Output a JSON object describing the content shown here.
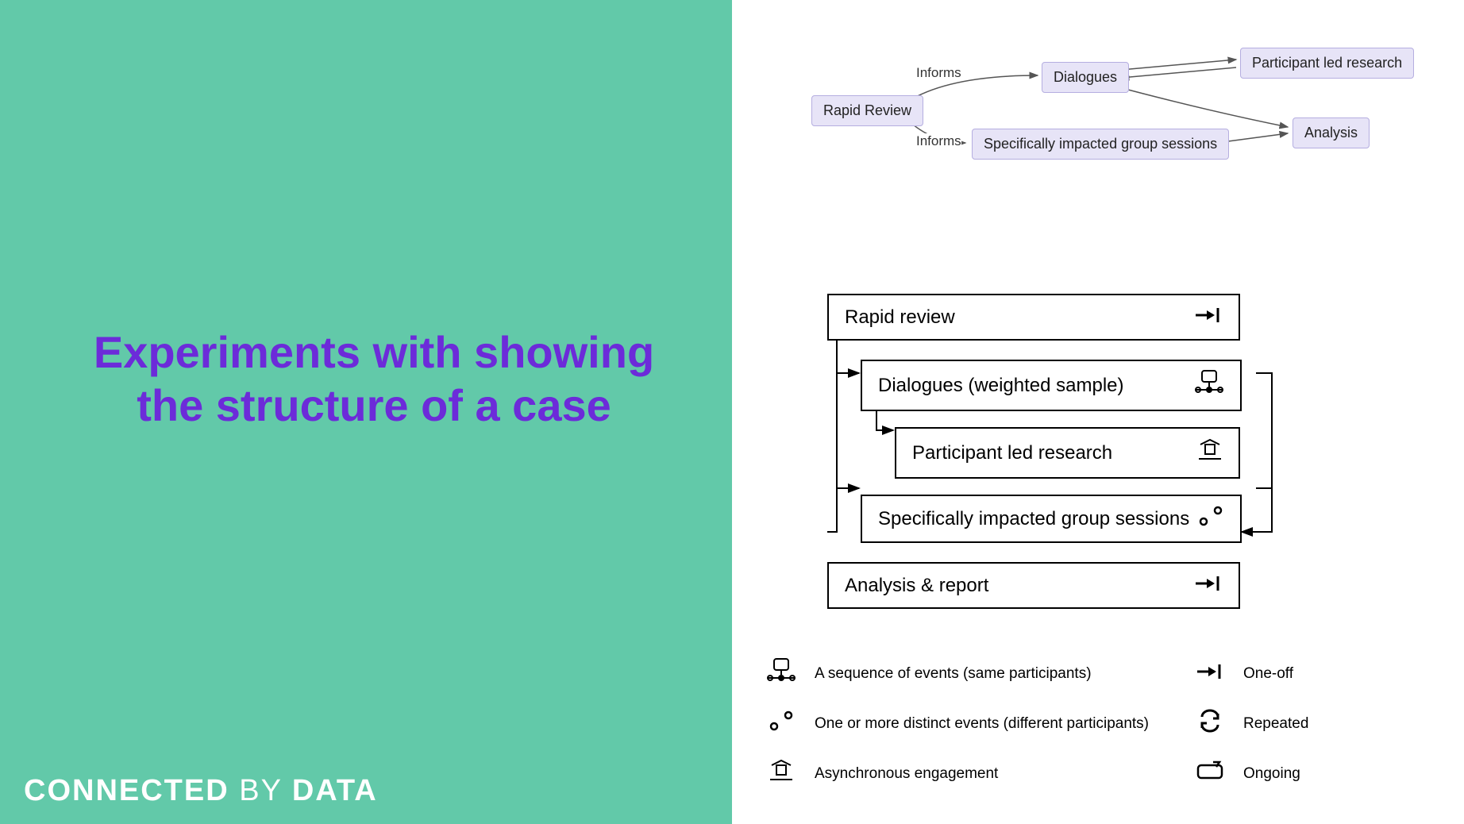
{
  "title": "Experiments with showing the structure of a case",
  "brand": {
    "bold": "CONNECTED",
    "middle": " BY ",
    "last": "DATA"
  },
  "flow": {
    "nodes": {
      "rapid_review": "Rapid Review",
      "dialogues": "Dialogues",
      "participant_led": "Participant led research",
      "impacted_sessions": "Specifically impacted group sessions",
      "analysis": "Analysis"
    },
    "labels": {
      "informs1": "Informs",
      "informs2": "Informs"
    }
  },
  "structure": {
    "rapid_review": "Rapid review",
    "dialogues": "Dialogues (weighted sample)",
    "participant_led": "Participant led research",
    "impacted_sessions": "Specifically impacted group sessions",
    "analysis_report": "Analysis & report"
  },
  "legend": {
    "sequence": "A sequence of events (same participants)",
    "distinct": "One or more distinct events (different participants)",
    "async": "Asynchronous engagement",
    "oneoff": "One-off",
    "repeated": "Repeated",
    "ongoing": "Ongoing"
  },
  "colors": {
    "left_bg": "#62c9a9",
    "title": "#6c2bd9",
    "node_fill": "#e7e4f7",
    "node_border": "#b5aee0"
  }
}
